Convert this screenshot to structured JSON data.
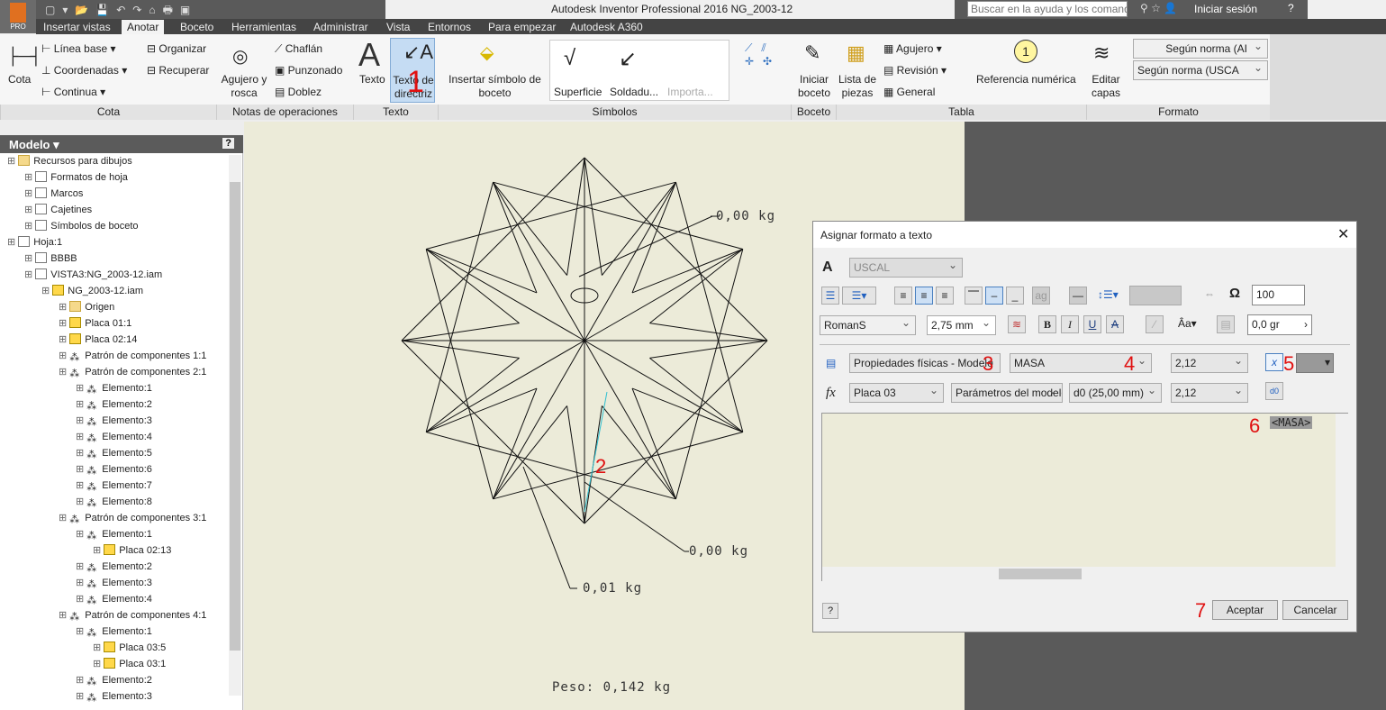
{
  "app": {
    "title": "Autodesk Inventor Professional 2016   NG_2003-12",
    "logo_badge": "PRO",
    "search_placeholder": "Buscar en la ayuda y los comandos",
    "signin": "Iniciar sesión"
  },
  "tabs": [
    {
      "label": "Insertar vistas"
    },
    {
      "label": "Anotar",
      "active": true
    },
    {
      "label": "Boceto"
    },
    {
      "label": "Herramientas"
    },
    {
      "label": "Administrar"
    },
    {
      "label": "Vista"
    },
    {
      "label": "Entornos"
    },
    {
      "label": "Para empezar"
    },
    {
      "label": "Autodesk A360"
    }
  ],
  "ribbon": {
    "cota": {
      "label": "Cota",
      "items": [
        "Línea base",
        "Coordenadas",
        "Continua",
        "Organizar",
        "Recuperar"
      ],
      "group": "Cota"
    },
    "notas": {
      "items": [
        "Agujero y rosca",
        "Chaflán",
        "Punzonado",
        "Doblez"
      ],
      "group": "Notas de operaciones"
    },
    "texto": {
      "items": [
        "Texto",
        "Texto de directriz"
      ],
      "group": "Texto"
    },
    "simbolos": {
      "items": [
        "Insertar símbolo de boceto",
        "Superficie",
        "Soldadu...",
        "Importa..."
      ],
      "group": "Símbolos"
    },
    "boceto": {
      "items": [
        "Iniciar boceto"
      ],
      "group": "Boceto"
    },
    "tabla": {
      "items": [
        "Lista de piezas",
        "Agujero",
        "Revisión",
        "General",
        "Referencia numérica"
      ],
      "balloon": "1",
      "group": "Tabla"
    },
    "formato": {
      "items": [
        "Editar capas",
        "Según norma (AI",
        "Según norma (USCA"
      ],
      "group": "Formato"
    }
  },
  "browser": {
    "title": "Modelo ▾",
    "nodes": [
      {
        "l": "Recursos para dibujos",
        "d": 0,
        "i": "folder"
      },
      {
        "l": "Formatos de hoja",
        "d": 1,
        "i": "sheet"
      },
      {
        "l": "Marcos",
        "d": 1,
        "i": "sheet"
      },
      {
        "l": "Cajetines",
        "d": 1,
        "i": "sheet"
      },
      {
        "l": "Símbolos de boceto",
        "d": 1,
        "i": "sheet"
      },
      {
        "l": "Hoja:1",
        "d": 0,
        "i": "sheet"
      },
      {
        "l": "BBBB",
        "d": 1,
        "i": "sheet"
      },
      {
        "l": "VISTA3:NG_2003-12.iam",
        "d": 1,
        "i": "view"
      },
      {
        "l": "NG_2003-12.iam",
        "d": 2,
        "i": "part"
      },
      {
        "l": "Origen",
        "d": 3,
        "i": "folder"
      },
      {
        "l": "Placa 01:1",
        "d": 3,
        "i": "part"
      },
      {
        "l": "Placa 02:14",
        "d": 3,
        "i": "part"
      },
      {
        "l": "Patrón de componentes 1:1",
        "d": 3,
        "i": "pat"
      },
      {
        "l": "Patrón de componentes 2:1",
        "d": 3,
        "i": "pat"
      },
      {
        "l": "Elemento:1",
        "d": 4,
        "i": "el"
      },
      {
        "l": "Elemento:2",
        "d": 4,
        "i": "el"
      },
      {
        "l": "Elemento:3",
        "d": 4,
        "i": "el"
      },
      {
        "l": "Elemento:4",
        "d": 4,
        "i": "el"
      },
      {
        "l": "Elemento:5",
        "d": 4,
        "i": "el"
      },
      {
        "l": "Elemento:6",
        "d": 4,
        "i": "el"
      },
      {
        "l": "Elemento:7",
        "d": 4,
        "i": "el"
      },
      {
        "l": "Elemento:8",
        "d": 4,
        "i": "el"
      },
      {
        "l": "Patrón de componentes 3:1",
        "d": 3,
        "i": "pat"
      },
      {
        "l": "Elemento:1",
        "d": 4,
        "i": "el"
      },
      {
        "l": "Placa 02:13",
        "d": 5,
        "i": "part"
      },
      {
        "l": "Elemento:2",
        "d": 4,
        "i": "el"
      },
      {
        "l": "Elemento:3",
        "d": 4,
        "i": "el"
      },
      {
        "l": "Elemento:4",
        "d": 4,
        "i": "el"
      },
      {
        "l": "Patrón de componentes 4:1",
        "d": 3,
        "i": "pat"
      },
      {
        "l": "Elemento:1",
        "d": 4,
        "i": "el"
      },
      {
        "l": "Placa 03:5",
        "d": 5,
        "i": "part"
      },
      {
        "l": "Placa 03:1",
        "d": 5,
        "i": "part"
      },
      {
        "l": "Elemento:2",
        "d": 4,
        "i": "el"
      },
      {
        "l": "Elemento:3",
        "d": 4,
        "i": "el"
      }
    ]
  },
  "drawing": {
    "labels": [
      "0,00 kg",
      "0,00 kg",
      "0,01 kg"
    ],
    "footer": "Peso: 0,142 kg",
    "markers": [
      "1",
      "2",
      "3",
      "4",
      "5",
      "6",
      "7"
    ]
  },
  "dialog": {
    "title": "Asignar formato a texto",
    "style": "USCAL",
    "width_pct": "100",
    "font": "RomanS",
    "size": "2,75 mm",
    "angle": "0,0 gr",
    "source": "Propiedades físicas - Modelo",
    "property": "MASA",
    "precision": "2,12",
    "component": "Placa 03",
    "param_source": "Parámetros del modelo",
    "param": "d0 (25,00 mm)",
    "param_precision": "2,12",
    "text": "<MASA>",
    "ok": "Aceptar",
    "cancel": "Cancelar"
  }
}
